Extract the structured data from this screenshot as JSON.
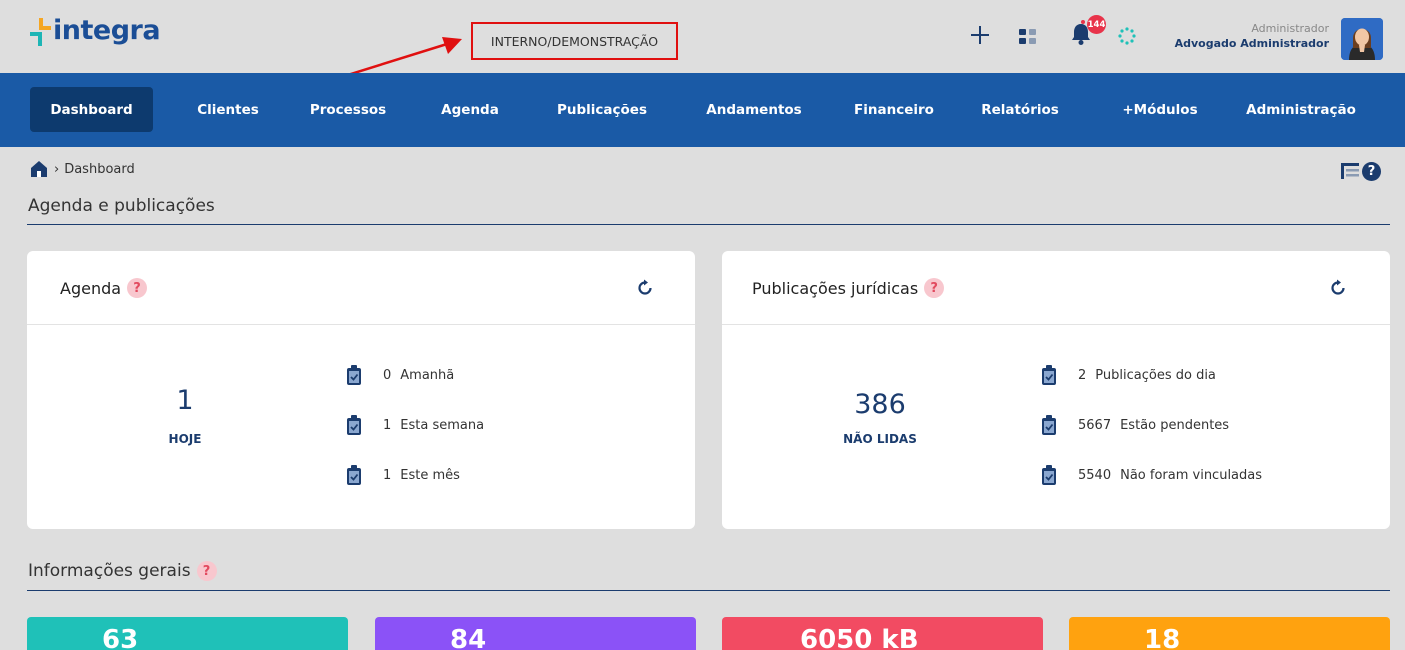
{
  "header": {
    "logo_text": "integra",
    "environment_label": "INTERNO/DEMONSTRAÇÃO",
    "notifications_count": "144",
    "user_role": "Administrador",
    "user_name": "Advogado Administrador"
  },
  "nav": {
    "items": [
      {
        "label": "Dashboard",
        "active": true
      },
      {
        "label": "Clientes"
      },
      {
        "label": "Processos"
      },
      {
        "label": "Agenda"
      },
      {
        "label": "Publicações"
      },
      {
        "label": "Andamentos"
      },
      {
        "label": "Financeiro"
      },
      {
        "label": "Relatórios"
      },
      {
        "label": "+Módulos"
      },
      {
        "label": "Administração"
      }
    ]
  },
  "breadcrumb": {
    "current": "Dashboard"
  },
  "sections": {
    "agenda_publicacoes": "Agenda e publicações",
    "informacoes_gerais": "Informações gerais"
  },
  "agenda_card": {
    "title": "Agenda",
    "main_value": "1",
    "main_label": "HOJE",
    "stats": [
      {
        "value": "0",
        "label": "Amanhã"
      },
      {
        "value": "1",
        "label": "Esta semana"
      },
      {
        "value": "1",
        "label": "Este mês"
      }
    ]
  },
  "publicacoes_card": {
    "title": "Publicações jurídicas",
    "main_value": "386",
    "main_label": "NÃO LIDAS",
    "stats": [
      {
        "value": "2",
        "label": "Publicações do dia"
      },
      {
        "value": "5667",
        "label": "Estão pendentes"
      },
      {
        "value": "5540",
        "label": "Não foram vinculadas"
      }
    ]
  },
  "tiles": [
    {
      "value": "63",
      "color": "#1fc1b8"
    },
    {
      "value": "84",
      "color": "#8b52f7"
    },
    {
      "value": "6050 kB",
      "color": "#f24b62"
    },
    {
      "value": "18",
      "color": "#ffa20f"
    }
  ],
  "colors": {
    "nav_bg": "#1a5aa6",
    "nav_active": "#0d3a6e",
    "brand_blue": "#1b3c6e",
    "annotation_red": "#e01010"
  },
  "icons": {
    "help": "?"
  }
}
